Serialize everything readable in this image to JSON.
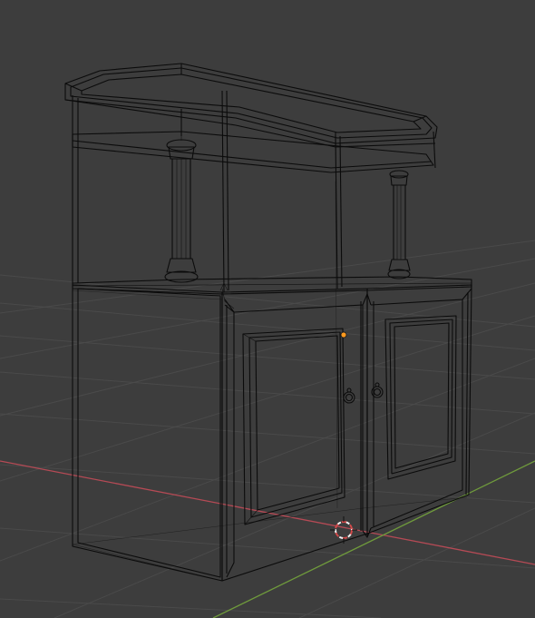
{
  "viewport": {
    "mode": "wireframe",
    "object": "cabinet",
    "colors": {
      "background": "#3d3d3d",
      "grid": "#4a4a4a",
      "x_axis": "#b54a55",
      "y_axis": "#6f9a3c",
      "wire": "#0b0b0b",
      "origin": "#ff9a1f",
      "cursor_red": "#d24a4a",
      "cursor_white": "#f0f0f0"
    },
    "icons": {
      "origin": "origin-dot-icon",
      "cursor": "3d-cursor-icon"
    }
  }
}
